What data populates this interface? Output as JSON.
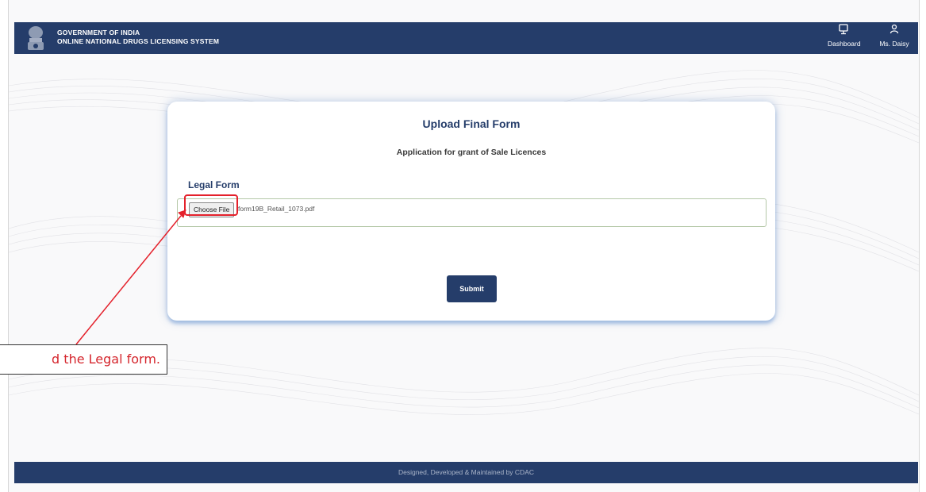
{
  "header": {
    "line1": "GOVERNMENT OF INDIA",
    "line2": "ONLINE NATIONAL DRUGS LICENSING SYSTEM",
    "nav": {
      "dashboard_label": "Dashboard",
      "user_label": "Ms. Daisy"
    }
  },
  "form": {
    "title": "Upload Final Form",
    "subtitle": "Application for grant of Sale Licences",
    "legal_label": "Legal Form",
    "choose_file_label": "Choose File",
    "file_name": "form19B_Retail_1073.pdf",
    "submit_label": "Submit"
  },
  "annotation": {
    "callout_text": "d the Legal form."
  },
  "footer": {
    "text": "Designed, Developed & Maintained by CDAC"
  },
  "icons": {
    "emblem": "national-emblem-icon",
    "dashboard": "monitor-icon",
    "user": "user-icon"
  },
  "colors": {
    "brand": "#253d6a",
    "highlight": "#e4212b"
  }
}
